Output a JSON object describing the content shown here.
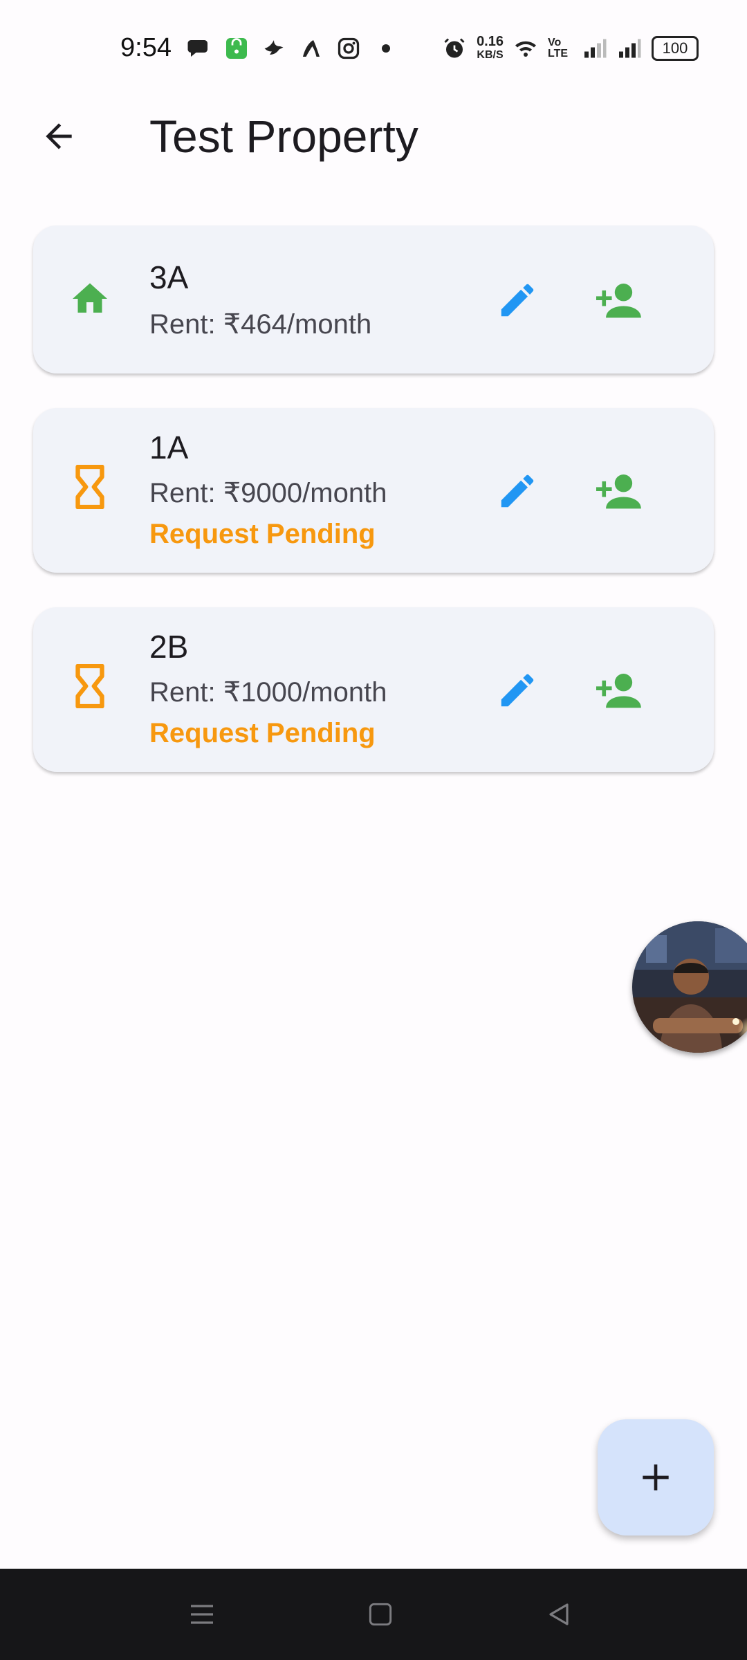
{
  "status_bar": {
    "time": "9:54",
    "net_speed_value": "0.16",
    "net_speed_unit": "KB/S",
    "volte": "Vo LTE",
    "battery": "100"
  },
  "header": {
    "title": "Test Property"
  },
  "units": [
    {
      "name": "3A",
      "rent": "Rent: ₹464/month",
      "status": "",
      "icon": "home-icon",
      "icon_color": "#4caf50"
    },
    {
      "name": "1A",
      "rent": "Rent: ₹9000/month",
      "status": "Request Pending",
      "icon": "hourglass-icon",
      "icon_color": "#f7980f"
    },
    {
      "name": "2B",
      "rent": "Rent: ₹1000/month",
      "status": "Request Pending",
      "icon": "hourglass-icon",
      "icon_color": "#f7980f"
    }
  ],
  "colors": {
    "edit": "#2196f3",
    "add_tenant": "#4caf50",
    "pending": "#f7980f",
    "fab_bg": "#d5e3fb",
    "card_bg": "#f1f3f9"
  },
  "icons": {
    "back": "arrow-left-icon",
    "edit": "pencil-icon",
    "add_tenant": "person-add-icon",
    "fab": "plus-icon"
  }
}
